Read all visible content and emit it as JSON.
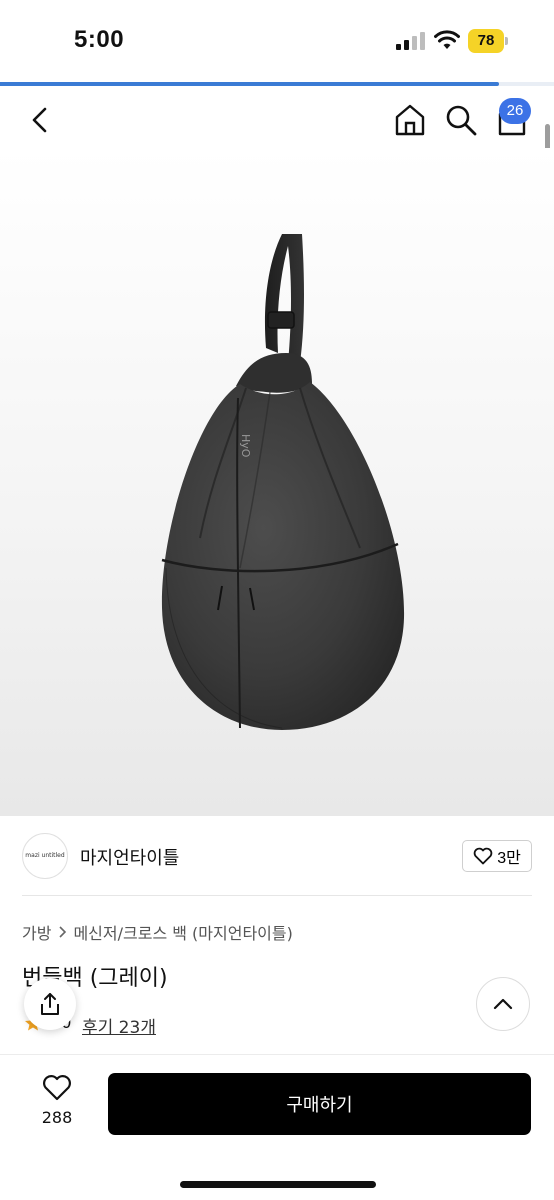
{
  "status_bar": {
    "time": "5:00",
    "battery": "78"
  },
  "page_progress": 0.9,
  "header": {
    "cart_count": "26"
  },
  "product_image": {
    "brand_mark": "HyO"
  },
  "seller": {
    "logo_text": "mazi untitled",
    "name": "마지언타이틀",
    "follow_count": "3만"
  },
  "breadcrumb": {
    "category": "가방",
    "subcategory": "메신저/크로스 백 (마지언타이틀)"
  },
  "product": {
    "title": "번들백 (그레이)",
    "rating": "5.0",
    "reviews": "후기 23개"
  },
  "bottom_bar": {
    "like_count": "288",
    "buy_label": "구매하기"
  },
  "colors": {
    "accent": "#3c72e6",
    "battery": "#f5d327",
    "buy_button": "#000000"
  }
}
